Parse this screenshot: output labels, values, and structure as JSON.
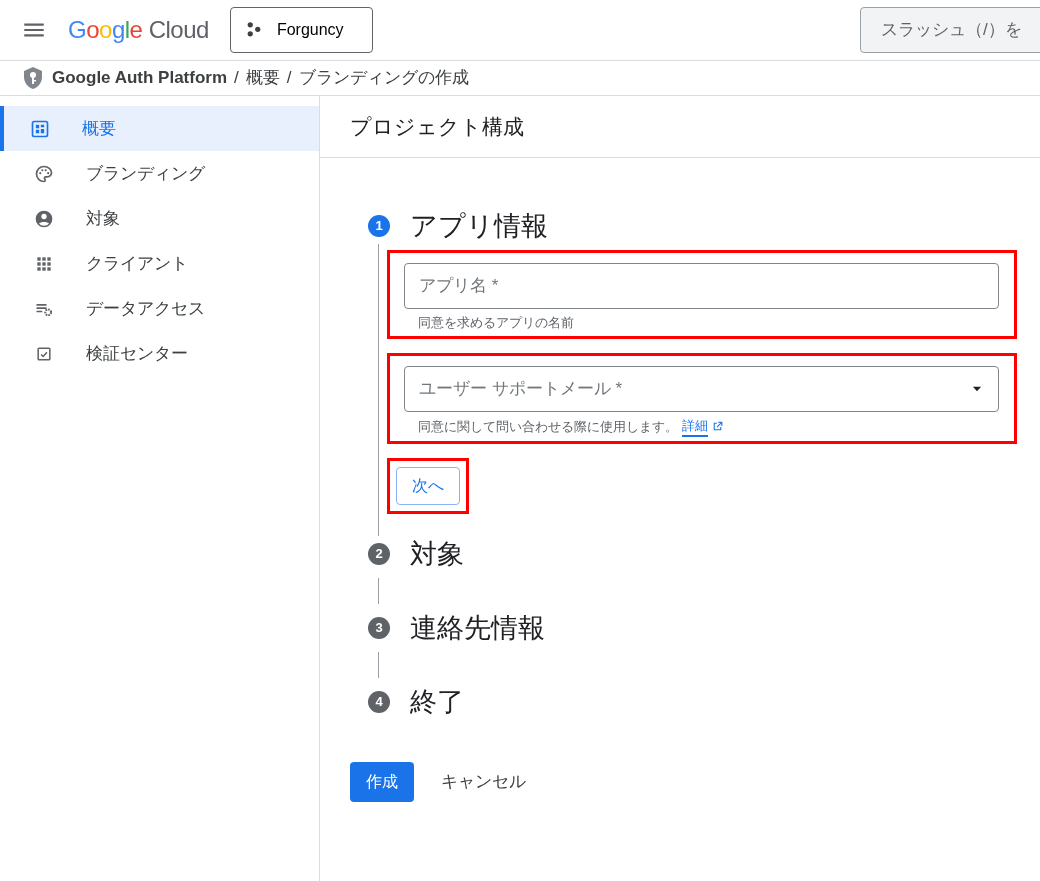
{
  "header": {
    "logo": "Google Cloud",
    "project": "Forguncy",
    "search": {
      "placeholder": "スラッシュ（/）を"
    }
  },
  "breadcrumb": [
    {
      "kind": "link",
      "text": "Google Auth Platform"
    },
    {
      "kind": "separator",
      "text": "/"
    },
    {
      "kind": "link",
      "text": "概要"
    },
    {
      "kind": "separator",
      "text": "/"
    },
    {
      "kind": "current",
      "text": "ブランディングの作成"
    }
  ],
  "sidebar": {
    "items": [
      {
        "label": "概要",
        "selected": true
      },
      {
        "label": "ブランディング",
        "selected": false
      },
      {
        "label": "対象",
        "selected": false
      },
      {
        "label": "クライアント",
        "selected": false
      },
      {
        "label": "データアクセス",
        "selected": false
      },
      {
        "label": "検証センター",
        "selected": false
      }
    ]
  },
  "page_title": "プロジェクト構成",
  "steps": [
    {
      "number": "1",
      "title": "アプリ情報",
      "selected": true
    },
    {
      "number": "2",
      "title": "対象",
      "selected": false
    },
    {
      "number": "3",
      "title": "連絡先情報",
      "selected": false
    },
    {
      "number": "4",
      "title": "終了",
      "selected": false
    }
  ],
  "form": {
    "fields": [
      {
        "kind": "text",
        "placeholder": "アプリ名 *",
        "hint": "同意を求めるアプリの名前",
        "highlighted": true
      },
      {
        "kind": "select",
        "placeholder": "ユーザー サポートメール *",
        "hint": "同意に関して問い合わせる際に使用します。",
        "link": "詳細",
        "highlighted": true
      }
    ],
    "next_button": {
      "label": "次へ",
      "highlighted": true
    }
  },
  "actions": {
    "create": "作成",
    "cancel": "キャンセル"
  }
}
